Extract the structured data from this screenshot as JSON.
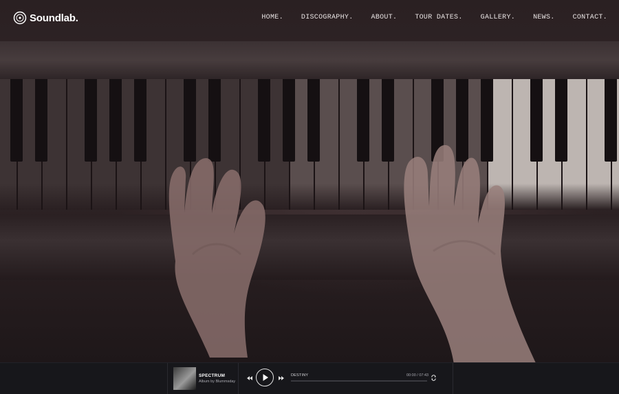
{
  "brand": {
    "name": "Soundlab."
  },
  "nav": {
    "items": [
      "HOME.",
      "DISCOGRAPHY.",
      "ABOUT.",
      "TOUR DATES.",
      "GALLERY.",
      "NEWS.",
      "CONTACT."
    ]
  },
  "player": {
    "album_title": "SPECTRUM",
    "album_subtitle": "Album by Blummsday",
    "now_playing": "DESTINY",
    "time": "00:00 / 07:43",
    "progress": 0.0
  },
  "colors": {
    "background": "#1a1416",
    "player_bg": "#17171b",
    "nav_text": "#e9e4e4"
  },
  "icons": [
    "logo-vinyl-icon",
    "previous-icon",
    "play-icon",
    "next-icon",
    "repeat-icon"
  ]
}
